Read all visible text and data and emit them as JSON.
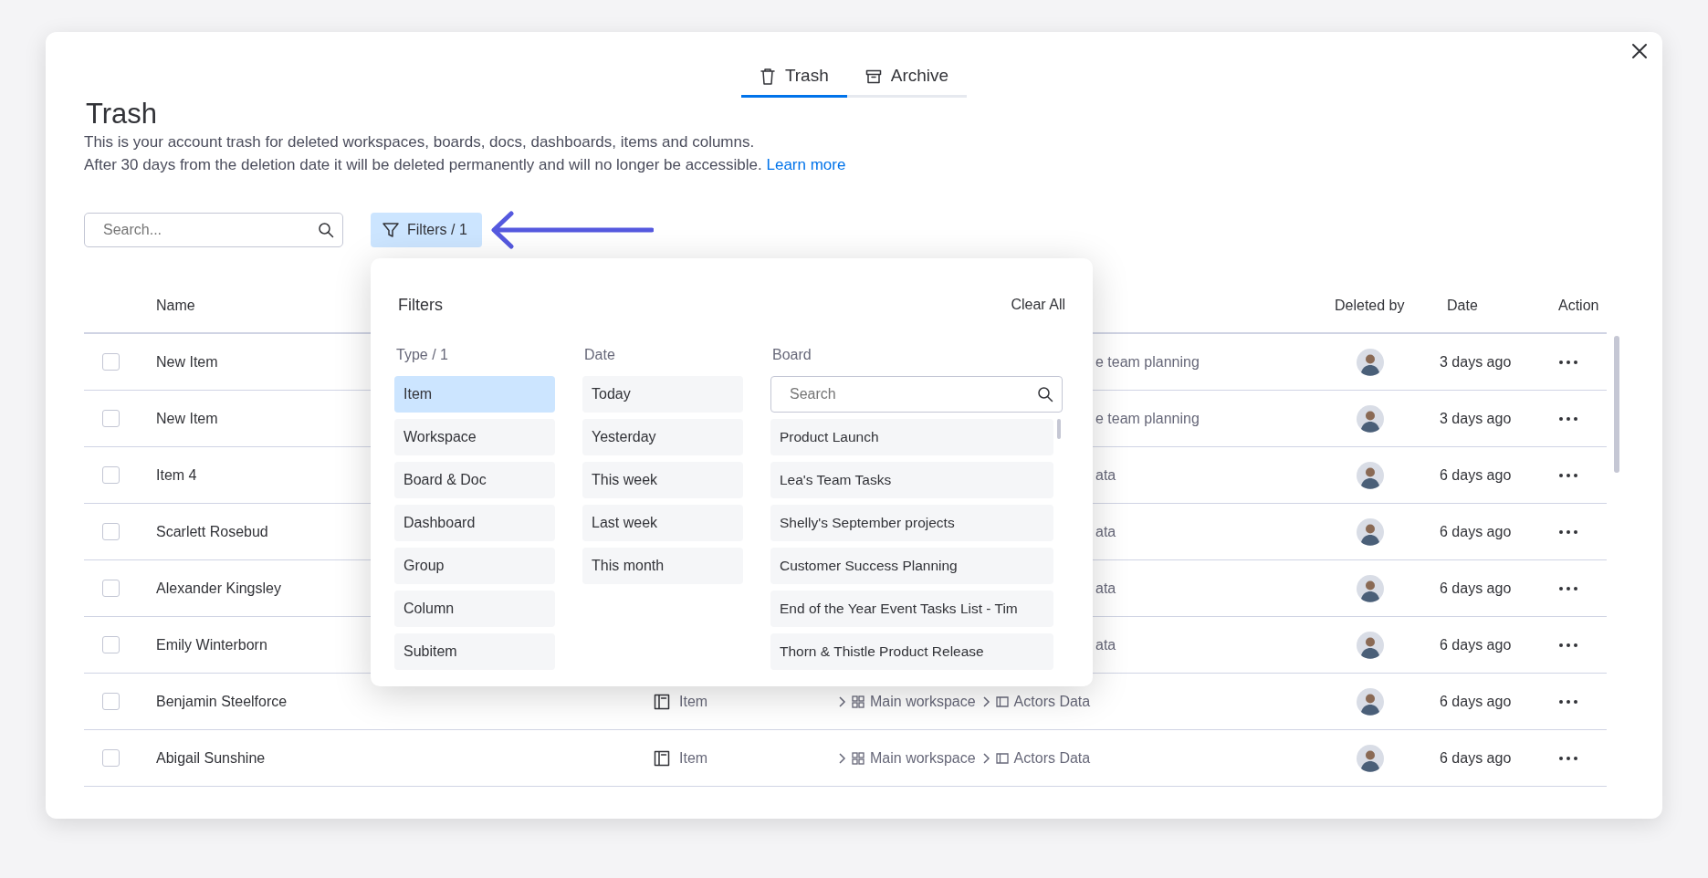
{
  "tabs": [
    {
      "label": "Trash",
      "selected": true
    },
    {
      "label": "Archive",
      "selected": false
    }
  ],
  "title": "Trash",
  "description": [
    "This is your account trash for deleted workspaces, boards, docs, dashboards, items and columns.",
    "After 30 days from the deletion date it will be deleted permanently and will no longer be accessible."
  ],
  "learn_more_link": "Learn more",
  "search": {
    "placeholder": "Search..."
  },
  "filters_button": {
    "label": "Filters / 1",
    "active": true
  },
  "table": {
    "columns": [
      "Name",
      "Deleted by",
      "Date",
      "Action"
    ],
    "rows": [
      {
        "name": "New Item",
        "checked": false,
        "location": {
          "kind": "clipped",
          "text": "e team planning"
        },
        "date": "3 days ago"
      },
      {
        "name": "New Item",
        "checked": false,
        "location": {
          "kind": "clipped",
          "text": "e team planning"
        },
        "date": "3 days ago"
      },
      {
        "name": "Item 4",
        "checked": false,
        "location": {
          "kind": "clipped",
          "text": "ata"
        },
        "date": "6 days ago"
      },
      {
        "name": "Scarlett Rosebud",
        "checked": false,
        "location": {
          "kind": "clipped",
          "text": "ata"
        },
        "date": "6 days ago"
      },
      {
        "name": "Alexander Kingsley",
        "checked": false,
        "location": {
          "kind": "clipped",
          "text": "ata"
        },
        "date": "6 days ago"
      },
      {
        "name": "Emily Winterborn",
        "checked": false,
        "location": {
          "kind": "clipped",
          "text": "ata"
        },
        "date": "6 days ago"
      },
      {
        "name": "Benjamin Steelforce",
        "checked": false,
        "type": "Item",
        "location": {
          "kind": "path",
          "workspace": "Main workspace",
          "board": "Actors Data"
        },
        "date": "6 days ago"
      },
      {
        "name": "Abigail Sunshine",
        "checked": false,
        "type": "Item",
        "location": {
          "kind": "path",
          "workspace": "Main workspace",
          "board": "Actors Data"
        },
        "date": "6 days ago"
      }
    ]
  },
  "filters_panel": {
    "title": "Filters",
    "clear_all": "Clear All",
    "type": {
      "label": "Type / 1",
      "options": [
        {
          "label": "Item",
          "selected": true
        },
        {
          "label": "Workspace",
          "selected": false
        },
        {
          "label": "Board & Doc",
          "selected": false
        },
        {
          "label": "Dashboard",
          "selected": false
        },
        {
          "label": "Group",
          "selected": false
        },
        {
          "label": "Column",
          "selected": false
        },
        {
          "label": "Subitem",
          "selected": false
        }
      ]
    },
    "date": {
      "label": "Date",
      "options": [
        {
          "label": "Today",
          "selected": false
        },
        {
          "label": "Yesterday",
          "selected": false
        },
        {
          "label": "This week",
          "selected": false
        },
        {
          "label": "Last week",
          "selected": false
        },
        {
          "label": "This month",
          "selected": false
        }
      ]
    },
    "board": {
      "label": "Board",
      "search_placeholder": "Search",
      "options": [
        {
          "label": "Product Launch",
          "selected": false
        },
        {
          "label": "Lea's Team Tasks",
          "selected": false
        },
        {
          "label": "Shelly's September projects",
          "selected": false
        },
        {
          "label": "Customer Success Planning",
          "selected": false
        },
        {
          "label": "End of the Year Event Tasks List - Tim",
          "selected": false
        },
        {
          "label": "Thorn & Thistle Product Release",
          "selected": false
        }
      ]
    }
  }
}
